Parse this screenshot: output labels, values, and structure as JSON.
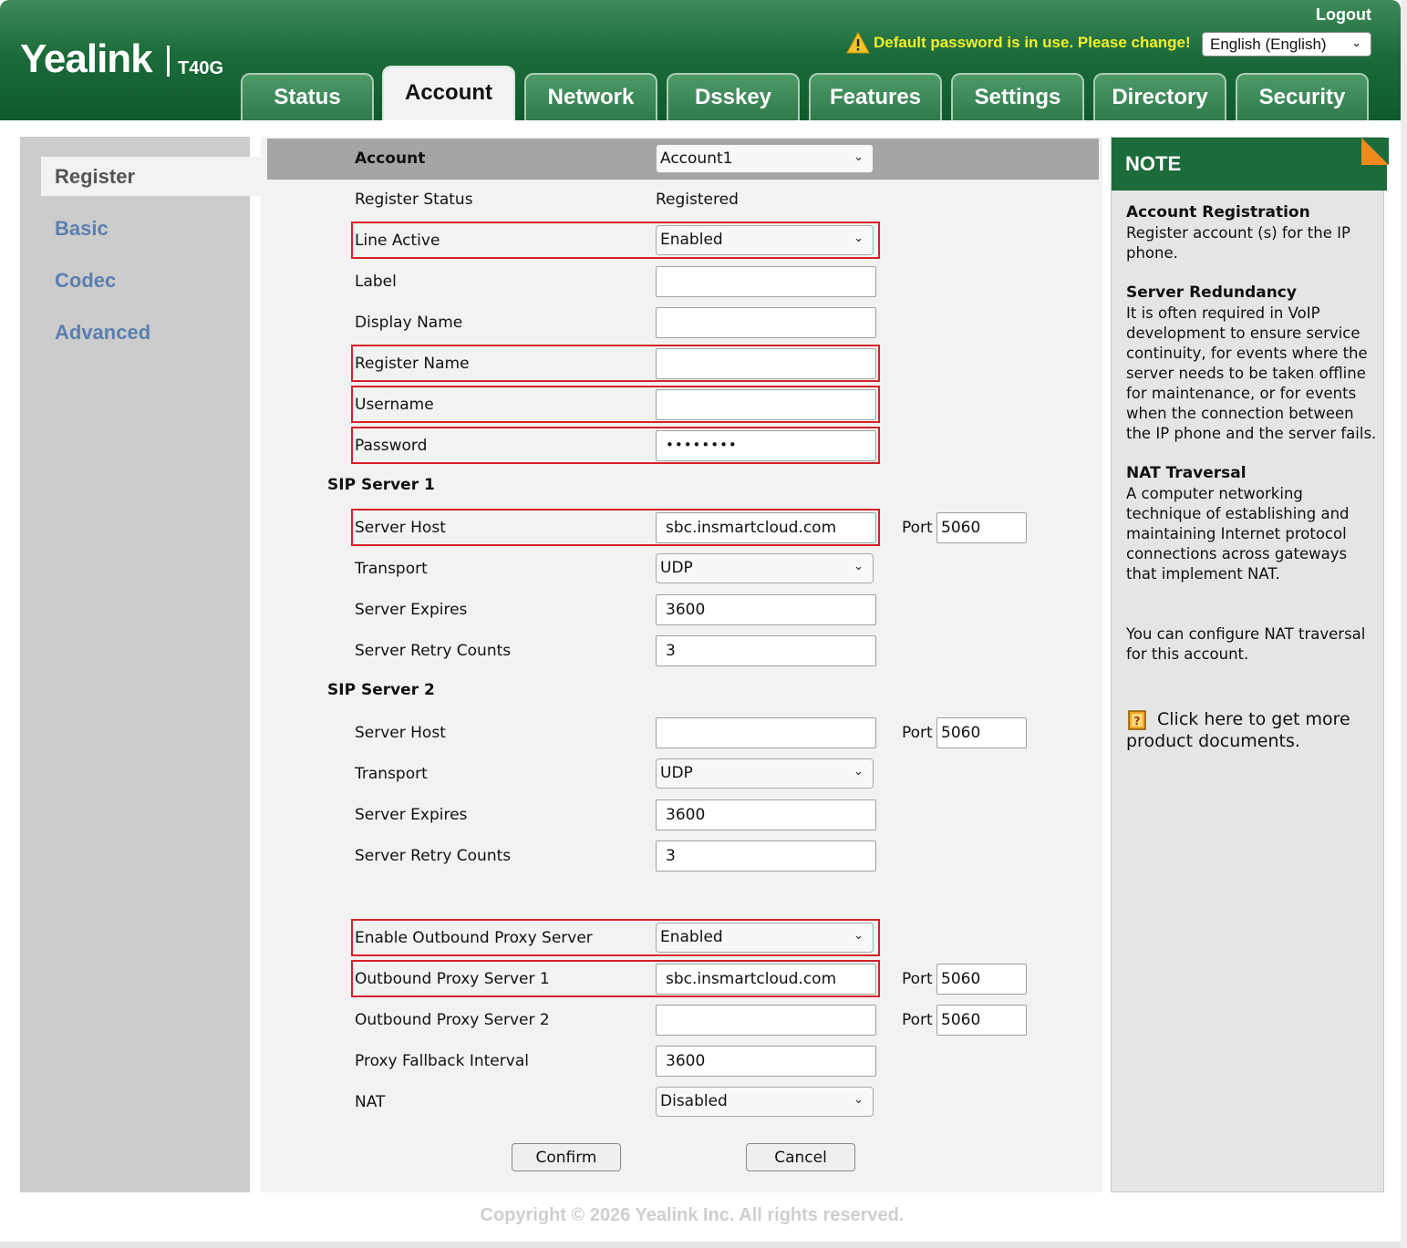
{
  "header": {
    "brand": "Yealink",
    "model": "T40G",
    "logout": "Logout",
    "warning": "Default password is in use. Please change!",
    "language": "English (English)",
    "tabs": [
      "Status",
      "Account",
      "Network",
      "Dsskey",
      "Features",
      "Settings",
      "Directory",
      "Security"
    ],
    "active_tab": "Account"
  },
  "sidebar": {
    "items": [
      "Register",
      "Basic",
      "Codec",
      "Advanced"
    ],
    "active": "Register"
  },
  "form": {
    "account_label": "Account",
    "account_value": "Account1",
    "register_status_label": "Register Status",
    "register_status_value": "Registered",
    "line_active_label": "Line Active",
    "line_active_value": "Enabled",
    "label_label": "Label",
    "label_value": "",
    "display_name_label": "Display Name",
    "display_name_value": "",
    "register_name_label": "Register Name",
    "register_name_value": "",
    "username_label": "Username",
    "username_value": "",
    "password_label": "Password",
    "password_value": "••••••••",
    "sip1": {
      "heading": "SIP Server 1",
      "host_label": "Server Host",
      "host_value": "sbc.insmartcloud.com",
      "port_label": "Port",
      "port_value": "5060",
      "transport_label": "Transport",
      "transport_value": "UDP",
      "expires_label": "Server Expires",
      "expires_value": "3600",
      "retry_label": "Server Retry Counts",
      "retry_value": "3"
    },
    "sip2": {
      "heading": "SIP Server 2",
      "host_label": "Server Host",
      "host_value": "",
      "port_label": "Port",
      "port_value": "5060",
      "transport_label": "Transport",
      "transport_value": "UDP",
      "expires_label": "Server Expires",
      "expires_value": "3600",
      "retry_label": "Server Retry Counts",
      "retry_value": "3"
    },
    "outbound": {
      "enable_label": "Enable Outbound Proxy Server",
      "enable_value": "Enabled",
      "proxy1_label": "Outbound Proxy Server 1",
      "proxy1_value": "sbc.insmartcloud.com",
      "proxy1_port": "5060",
      "proxy2_label": "Outbound Proxy Server 2",
      "proxy2_value": "",
      "proxy2_port": "5060",
      "port_label": "Port",
      "fallback_label": "Proxy Fallback Interval",
      "fallback_value": "3600",
      "nat_label": "NAT",
      "nat_value": "Disabled"
    },
    "confirm": "Confirm",
    "cancel": "Cancel"
  },
  "note": {
    "title": "NOTE",
    "sections": [
      {
        "heading": "Account Registration",
        "body": "Register account (s) for the IP phone."
      },
      {
        "heading": "Server Redundancy",
        "body": "It is often required in VoIP development to ensure service continuity, for events where the server needs to be taken offline for maintenance, or for events when the connection between the IP phone and the server fails."
      },
      {
        "heading": "NAT Traversal",
        "body": "A computer networking technique of establishing and maintaining Internet protocol connections across gateways that implement NAT."
      }
    ],
    "nat_note": "You can configure NAT traversal for this account.",
    "doc_link": "Click here to get more product documents."
  },
  "footer": {
    "copyright": "Copyright © 2026 Yealink Inc. All rights reserved."
  },
  "colors": {
    "header_green": "#1c6b3b",
    "highlight_red": "#d6202a",
    "warning_yellow": "#f4ee2a",
    "nav_link": "#5b7fae"
  },
  "icons": {
    "warning": "warning-triangle-icon",
    "dropdown": "chevron-down-icon",
    "document": "document-icon"
  }
}
